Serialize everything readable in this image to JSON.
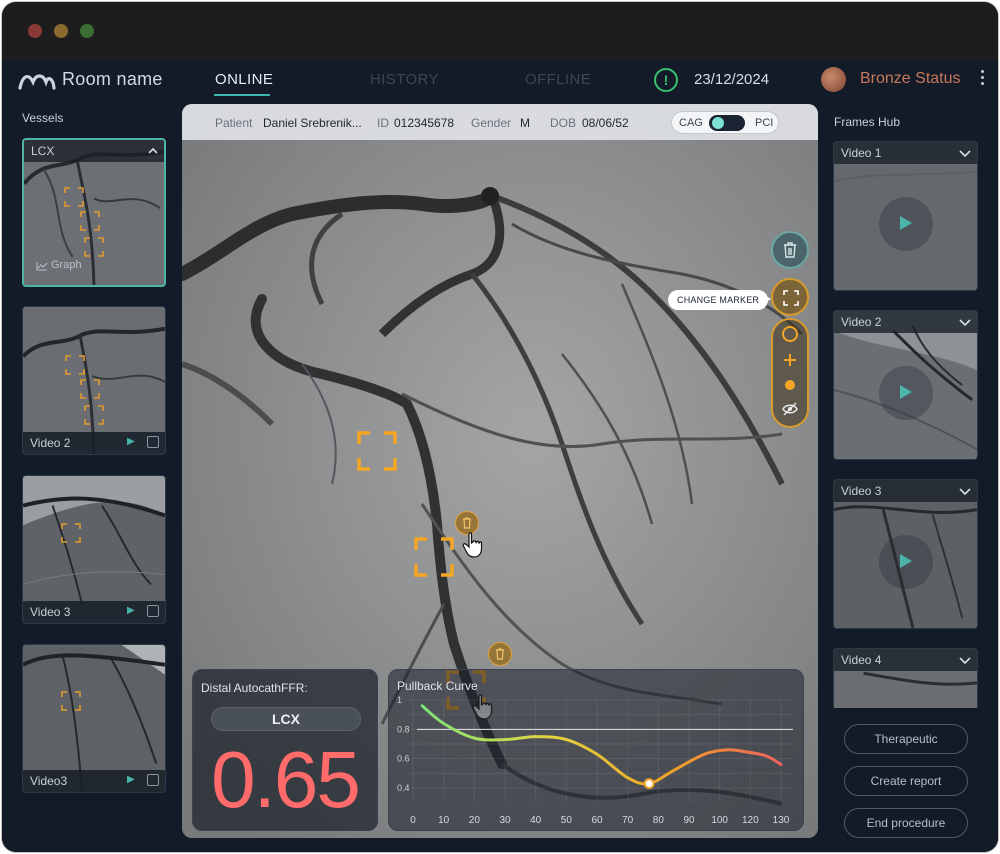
{
  "window": {
    "controls": [
      "close",
      "minimize",
      "maximize"
    ]
  },
  "header": {
    "room_name": "Room name",
    "tabs": [
      {
        "label": "ONLINE",
        "active": true
      },
      {
        "label": "HISTORY",
        "active": false
      },
      {
        "label": "OFFLINE",
        "active": false
      }
    ],
    "alert_symbol": "!",
    "date": "23/12/2024",
    "status": "Bronze Status"
  },
  "vessels": {
    "title": "Vessels",
    "items": [
      {
        "label": "LCX",
        "selected": true,
        "graph_label": "Graph"
      },
      {
        "label": "Video 2"
      },
      {
        "label": "Video 3"
      },
      {
        "label": "Video3"
      }
    ]
  },
  "patient": {
    "patient_key": "Patient",
    "patient_name": "Daniel Srebrenik...",
    "id_key": "ID",
    "id_value": "012345678",
    "gender_key": "Gender",
    "gender_value": "M",
    "dob_key": "DOB",
    "dob_value": "08/06/52",
    "mode_left": "CAG",
    "mode_right": "PCI",
    "mode_selected": "CAG"
  },
  "tools": {
    "tooltip": "CHANGE MARKER"
  },
  "ffr": {
    "title": "Distal AutocathFFR:",
    "vessel": "LCX",
    "value": "0.65",
    "value_color": "#ff6a6a"
  },
  "pullback": {
    "title": "Pullback Curve",
    "chart_data": {
      "type": "line",
      "title": "Pullback Curve",
      "x_ticks": [
        0,
        10,
        20,
        30,
        40,
        50,
        60,
        70,
        80,
        90,
        100,
        120,
        130
      ],
      "y_ticks": [
        0.4,
        0.6,
        0.8,
        1
      ],
      "ylim": [
        0.4,
        1
      ],
      "threshold": 0.8,
      "series": [
        {
          "x": [
            3,
            10,
            20,
            30,
            40,
            50,
            60,
            70,
            77,
            85,
            95,
            105,
            115,
            125,
            130
          ],
          "values": [
            0.96,
            0.84,
            0.74,
            0.73,
            0.75,
            0.73,
            0.63,
            0.47,
            0.43,
            0.52,
            0.63,
            0.66,
            0.65,
            0.62,
            0.56
          ]
        }
      ],
      "marker": {
        "x": 77,
        "y": 0.43
      },
      "gradient_colors": [
        "#7de37a",
        "#e3d440",
        "#f0a026",
        "#f06060"
      ]
    }
  },
  "frames_hub": {
    "title": "Frames Hub",
    "items": [
      {
        "label": "Video 1"
      },
      {
        "label": "Video 2"
      },
      {
        "label": "Video 3"
      },
      {
        "label": "Video 4"
      }
    ]
  },
  "actions": {
    "therapeutic": "Therapeutic",
    "create_report": "Create report",
    "end_procedure": "End procedure"
  },
  "colors": {
    "accent_teal": "#3fb7ae",
    "marker_orange": "#f5a623",
    "status_copper": "#c7795a",
    "alert_green": "#38c172"
  }
}
